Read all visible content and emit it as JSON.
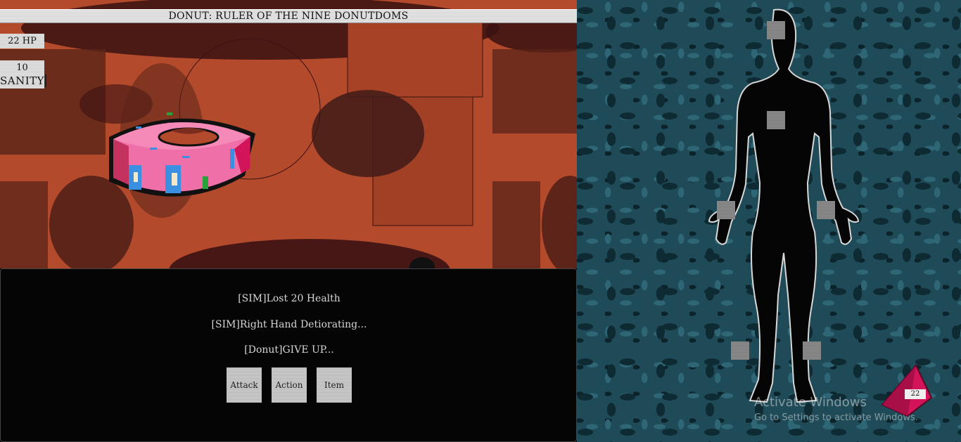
{
  "boss": {
    "title": "DONUT: RULER OF THE NINE DONUTDOMS"
  },
  "stats": {
    "hp_label": "22 HP",
    "sanity_value": "10",
    "sanity_label": "SANITY"
  },
  "log": {
    "messages": [
      "[SIM]Lost 20 Health",
      "[SIM]Right Hand Detiorating...",
      "[Donut]GIVE UP..."
    ]
  },
  "commands": {
    "attack": "Attack",
    "action": "Action",
    "item": "Item"
  },
  "body": {
    "limbs": [
      "head",
      "torso",
      "left-hand",
      "right-hand",
      "left-foot",
      "right-foot"
    ]
  },
  "die": {
    "value": "22",
    "color": "#d4145a"
  },
  "watermark": {
    "line1": "Activate Windows",
    "line2": "Go to Settings to activate Windows."
  },
  "colors": {
    "scene_bg": "#b44a2c",
    "donut_frosting": "#ef6fa8",
    "body_panel": "#1f4a57"
  }
}
